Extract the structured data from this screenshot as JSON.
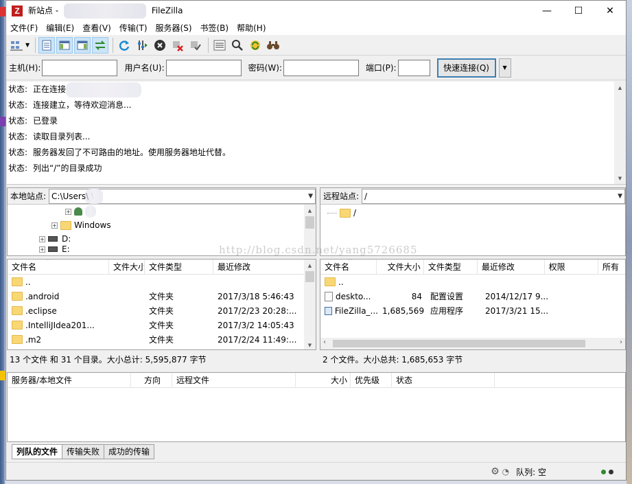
{
  "window": {
    "title_left": "新站点 -",
    "title_right": "FileZilla",
    "minimize": "—",
    "maximize": "☐",
    "close": "✕"
  },
  "menu": [
    "文件(F)",
    "编辑(E)",
    "查看(V)",
    "传输(T)",
    "服务器(S)",
    "书签(B)",
    "帮助(H)"
  ],
  "quickconnect": {
    "host_label": "主机(H):",
    "user_label": "用户名(U):",
    "pass_label": "密码(W):",
    "port_label": "端口(P):",
    "host_value": "",
    "user_value": "",
    "pass_value": "",
    "port_value": "",
    "button_label": "快速连接(Q)"
  },
  "log": {
    "prefix": "状态:",
    "lines": [
      "正在连接",
      "连接建立，等待欢迎消息...",
      "已登录",
      "读取目录列表...",
      "服务器发回了不可路由的地址。使用服务器地址代替。",
      "列出“/”的目录成功"
    ]
  },
  "local": {
    "site_label": "本地站点:",
    "path": "C:\\Users\\            \\",
    "tree": [
      "",
      "Windows",
      "D:",
      "E:"
    ],
    "headers": [
      "文件名",
      "文件大小",
      "文件类型",
      "最近修改"
    ],
    "files": [
      {
        "name": "..",
        "size": "",
        "type": "",
        "modified": ""
      },
      {
        "name": ".android",
        "size": "",
        "type": "文件夹",
        "modified": "2017/3/18 5:46:43"
      },
      {
        "name": ".eclipse",
        "size": "",
        "type": "文件夹",
        "modified": "2017/2/23 20:28:..."
      },
      {
        "name": ".IntelliJIdea201...",
        "size": "",
        "type": "文件夹",
        "modified": "2017/3/2 14:05:43"
      },
      {
        "name": ".m2",
        "size": "",
        "type": "文件夹",
        "modified": "2017/2/24 11:49:..."
      }
    ],
    "status": "13 个文件 和 31 个目录。大小总计: 5,595,877 字节"
  },
  "remote": {
    "site_label": "远程站点:",
    "path": "/",
    "tree": [
      "/"
    ],
    "headers": [
      "文件名",
      "文件大小",
      "文件类型",
      "最近修改",
      "权限",
      "所有"
    ],
    "files": [
      {
        "name": "..",
        "size": "",
        "type": "",
        "modified": "",
        "perm": ""
      },
      {
        "name": "deskto...",
        "size": "84",
        "type": "配置设置",
        "modified": "2014/12/17 9...",
        "perm": ""
      },
      {
        "name": "FileZilla_...",
        "size": "1,685,569",
        "type": "应用程序",
        "modified": "2017/3/21 15...",
        "perm": ""
      }
    ],
    "status": "2 个文件。大小总共: 1,685,653 字节"
  },
  "queue": {
    "headers": [
      "服务器/本地文件",
      "方向",
      "远程文件",
      "大小",
      "优先级",
      "状态"
    ],
    "tabs": [
      "列队的文件",
      "传输失败",
      "成功的传输"
    ]
  },
  "statusbar": {
    "queue_text": "队列: 空"
  },
  "watermark": "http://blog.csdn.net/yang5726685",
  "colors": {
    "accent": "#3c7fb1",
    "folder": "#f8d775",
    "led_green": "#2e8b2e",
    "led_dark": "#333333"
  }
}
